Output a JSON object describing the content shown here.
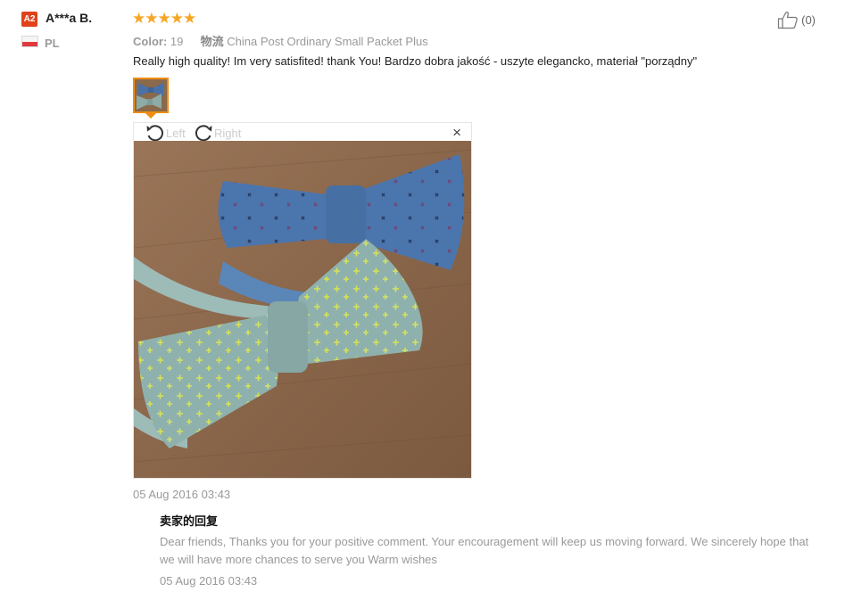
{
  "reviewer": {
    "level_badge": "A2",
    "name": "A***a B.",
    "country_code": "PL",
    "flag_colors": [
      "#f5f5f5",
      "#e03a3e"
    ]
  },
  "review": {
    "rating": 5,
    "stars": "★★★★★",
    "star_color": "#f6a623",
    "color_label": "Color:",
    "color_value": "19",
    "logistics_label": "物流",
    "logistics_value": "China Post Ordinary Small Packet Plus",
    "text": "Really high quality! Im very satisfited! thank You! Bardzo dobra jakość - uszyte elegancko, materiał \"porządny\"",
    "helpful_count": "(0)",
    "date": "05 Aug 2016 03:43"
  },
  "viewer": {
    "rotate_left_label": "Left",
    "rotate_right_label": "Right",
    "close_glyph": "×",
    "thumb_border_color": "#f08c12"
  },
  "seller_reply": {
    "title": "卖家的回复",
    "text": "Dear friends, Thanks you for your positive comment. Your encouragement will keep us moving forward. We sincerely hope that we will have more chances to serve you Warm wishes",
    "date": "05 Aug 2016 03:43"
  },
  "icons": {
    "thumbs_up": "thumbs-up-icon",
    "rotate_left": "rotate-left-icon",
    "rotate_right": "rotate-right-icon",
    "close": "close-icon"
  }
}
